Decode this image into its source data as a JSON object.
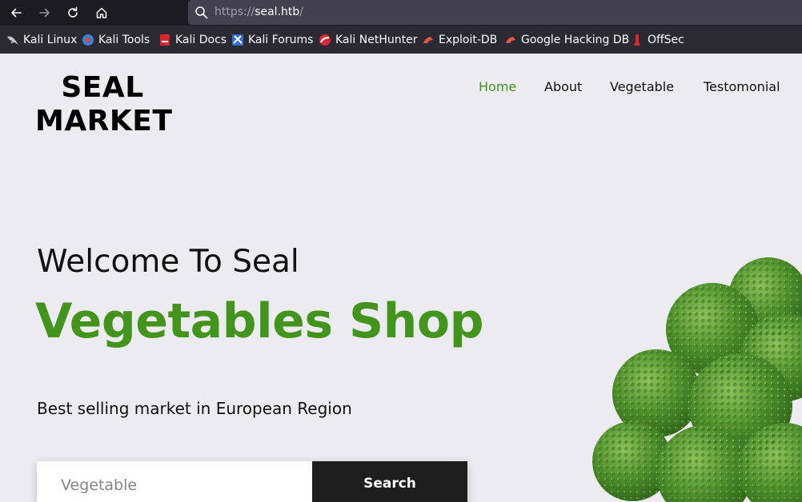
{
  "browser": {
    "url_scheme": "https://",
    "url_host": "seal.htb",
    "url_path": "/",
    "bookmarks": [
      {
        "label": "Kali Linux"
      },
      {
        "label": "Kali Tools"
      },
      {
        "label": "Kali Docs"
      },
      {
        "label": "Kali Forums"
      },
      {
        "label": "Kali NetHunter"
      },
      {
        "label": "Exploit-DB"
      },
      {
        "label": "Google Hacking DB"
      },
      {
        "label": "OffSec"
      }
    ]
  },
  "site": {
    "logo_line1": "SEAL",
    "logo_line2": "MARKET",
    "nav": [
      {
        "label": "Home",
        "active": true
      },
      {
        "label": "About",
        "active": false
      },
      {
        "label": "Vegetable",
        "active": false
      },
      {
        "label": "Testomonial",
        "active": false
      }
    ],
    "hero": {
      "welcome": "Welcome To Seal",
      "headline": "Vegetables Shop",
      "tagline": "Best selling market in European Region"
    },
    "search": {
      "placeholder": "Vegetable",
      "button_label": "Search"
    },
    "colors": {
      "accent_green": "#42941d",
      "background": "#ececf0",
      "button_dark": "#1e1e1e"
    }
  }
}
